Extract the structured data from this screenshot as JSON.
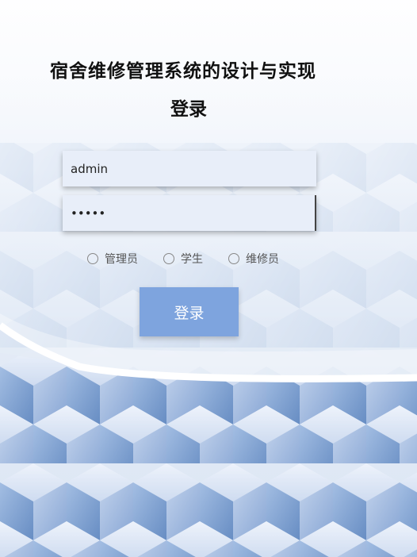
{
  "header": {
    "title": "宿舍维修管理系统的设计与实现",
    "subtitle": "登录"
  },
  "form": {
    "username_value": "admin",
    "password_value": "•••••",
    "roles": [
      "管理员",
      "学生",
      "维修员"
    ],
    "login_label": "登录"
  },
  "colors": {
    "button": "#7ea4de",
    "input_bg": "#e8eef9",
    "background": "#eaf0f8"
  }
}
